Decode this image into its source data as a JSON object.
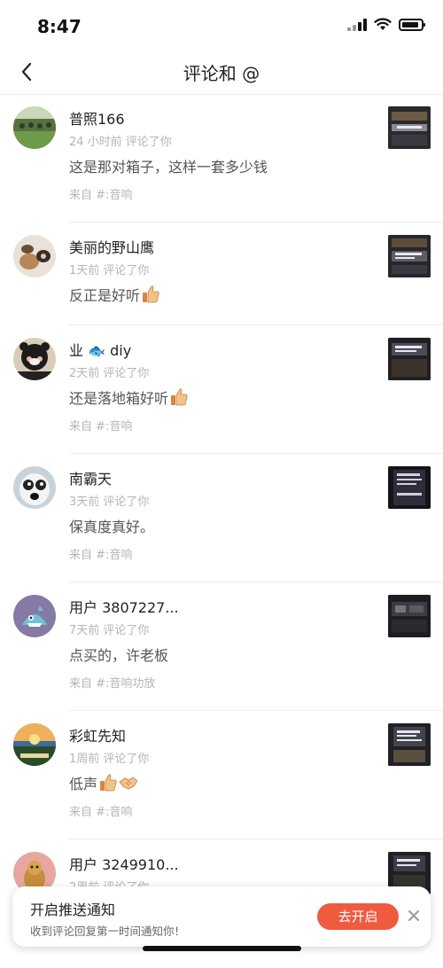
{
  "status_bar": {
    "time": "8:47"
  },
  "nav": {
    "title": "评论和 @"
  },
  "comments": [
    {
      "username": "普照166",
      "meta": "24 小时前 评论了你",
      "text": "这是那对箱子，这样一套多少钱",
      "source": "来自 #:音响"
    },
    {
      "username": "美丽的野山鹰",
      "meta": "1天前 评论了你",
      "text": "反正是好听",
      "source": ""
    },
    {
      "username": "业 🐟 diy",
      "meta": "2天前 评论了你",
      "text": "还是落地箱好听",
      "source": "来自 #:音响"
    },
    {
      "username": "南霸天",
      "meta": "3天前 评论了你",
      "text": "保真度真好。",
      "source": "来自 #:音响"
    },
    {
      "username": "用户 3807227...",
      "meta": "7天前 评论了你",
      "text": "点买的，许老板",
      "source": "来自 #:音响功放"
    },
    {
      "username": "彩虹先知",
      "meta": "1周前 评论了你",
      "text": "低声",
      "source": "来自 #:音响"
    },
    {
      "username": "用户 3249910...",
      "meta": "2周前 评论了你",
      "text": "",
      "source": ""
    }
  ],
  "notification": {
    "title": "开启推送通知",
    "subtitle": "收到评论回复第一时间通知你！",
    "button": "去开启",
    "close": "×"
  }
}
